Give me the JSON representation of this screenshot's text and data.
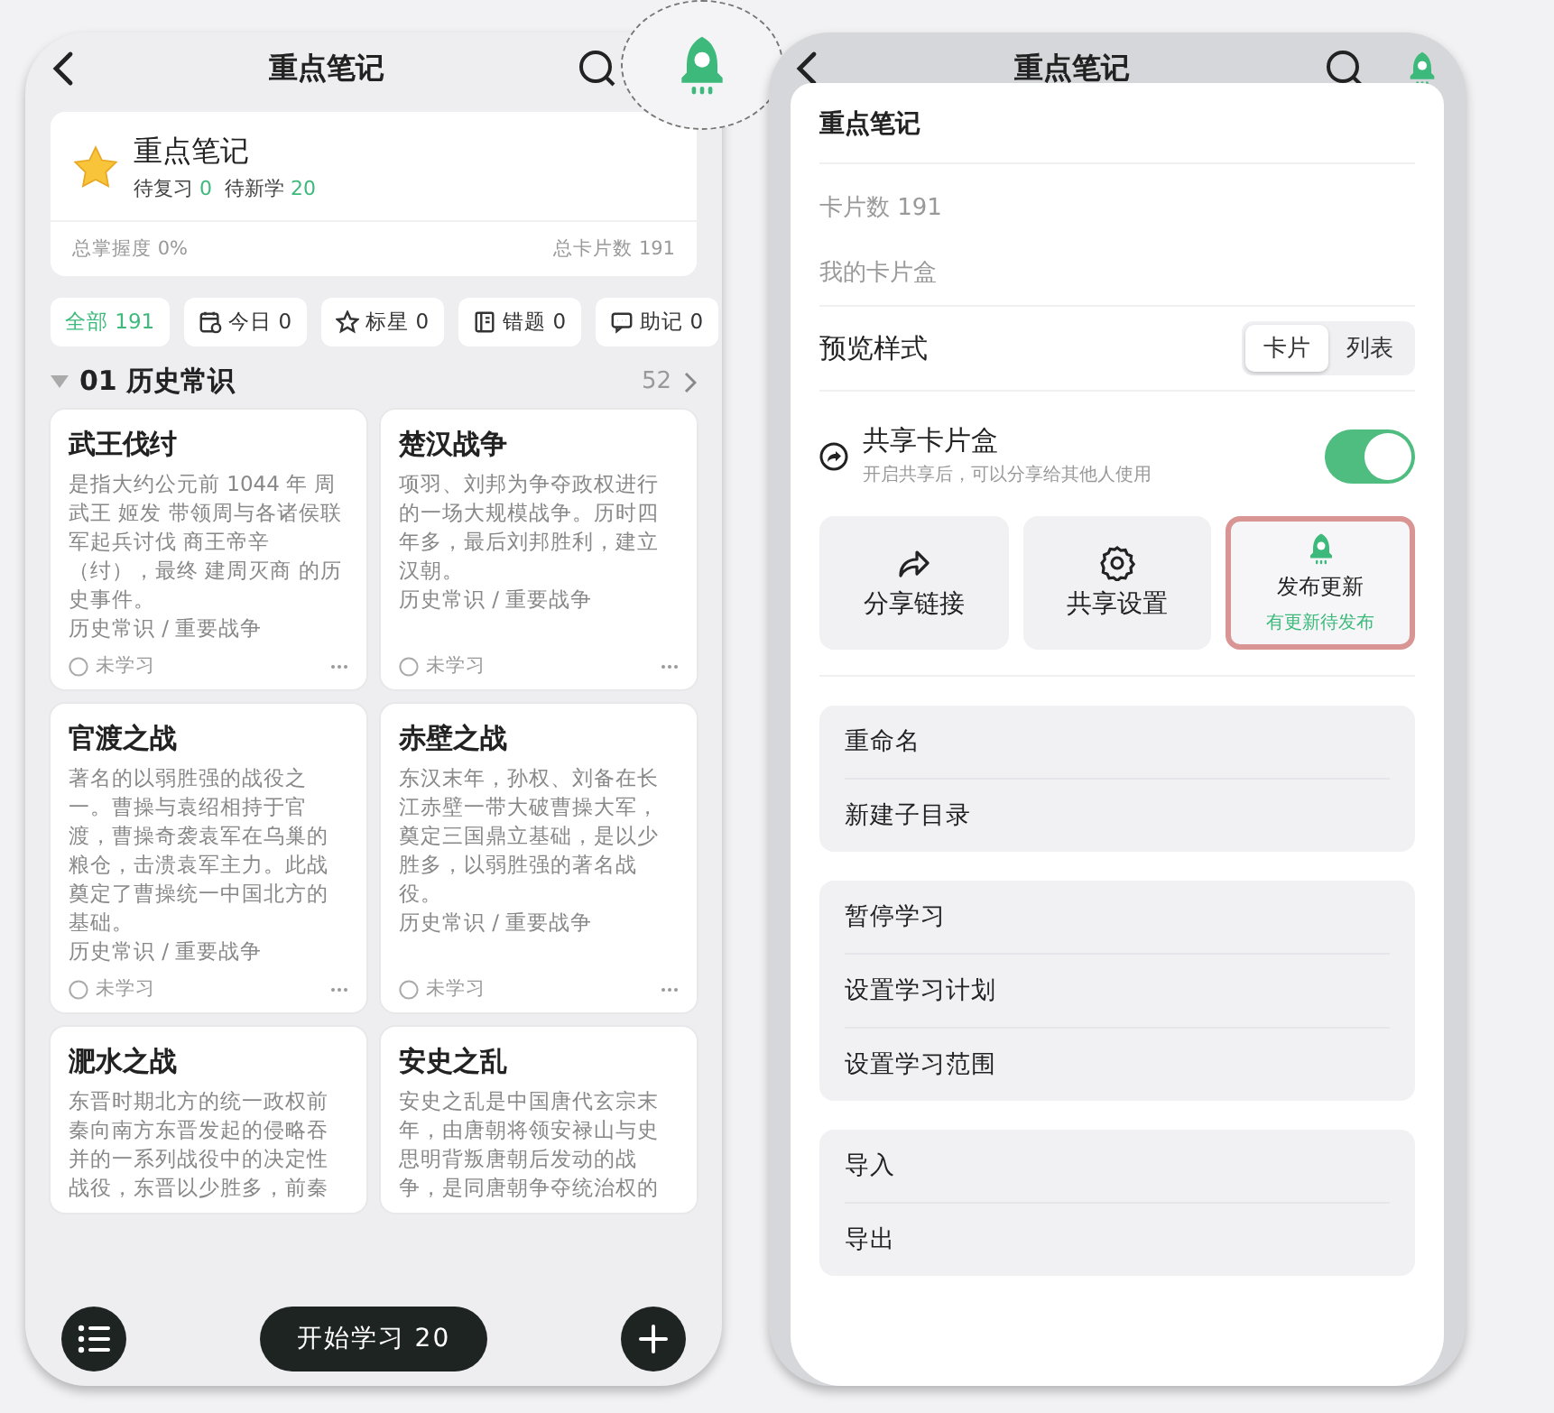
{
  "left": {
    "nav": {
      "title": "重点笔记",
      "rocket_highlighted": true
    },
    "deck": {
      "title": "重点笔记",
      "review_label": "待复习",
      "review_count": "0",
      "new_label": "待新学",
      "new_count": "20",
      "mastery": "总掌握度 0%",
      "total": "总卡片数 191"
    },
    "filters": [
      {
        "kind": "all",
        "label": "全部 191",
        "selected": true
      },
      {
        "kind": "today",
        "label": "今日 0",
        "selected": false
      },
      {
        "kind": "star",
        "label": "标星 0",
        "selected": false
      },
      {
        "kind": "wrong",
        "label": "错题 0",
        "selected": false
      },
      {
        "kind": "mnemonic",
        "label": "助记 0",
        "selected": false
      }
    ],
    "section": {
      "title": "01 历史常识",
      "count": "52",
      "expanded": true
    },
    "cards": [
      {
        "title": "武王伐纣",
        "description": "是指大约公元前 1044 年 周武王 姬发 带领周与各诸侯联军起兵讨伐 商王帝辛（纣），最终 建周灭商 的历史事件。",
        "category": "历史常识 / 重要战争",
        "status": "未学习"
      },
      {
        "title": "楚汉战争",
        "description": "项羽、刘邦为争夺政权进行的一场大规模战争。历时四年多，最后刘邦胜利，建立汉朝。",
        "category": "历史常识 / 重要战争",
        "status": "未学习"
      },
      {
        "title": "官渡之战",
        "description": "著名的以弱胜强的战役之一。曹操与袁绍相持于官渡，曹操奇袭袁军在乌巢的粮仓，击溃袁军主力。此战奠定了曹操统一中国北方的基础。",
        "category": "历史常识 / 重要战争",
        "status": "未学习"
      },
      {
        "title": "赤壁之战",
        "description": "东汉末年，孙权、刘备在长江赤壁一带大破曹操大军，奠定三国鼎立基础，是以少胜多，以弱胜强的著名战役。",
        "category": "历史常识 / 重要战争",
        "status": "未学习"
      },
      {
        "title": "淝水之战",
        "description": "东晋时期北方的统一政权前秦向南方东晋发起的侵略吞并的一系列战役中的决定性战役，东晋以少胜多，前秦"
      },
      {
        "title": "安史之乱",
        "description": "安史之乱是中国唐代玄宗末年，由唐朝将领安禄山与史思明背叛唐朝后发动的战争，是同唐朝争夺统治权的"
      }
    ],
    "start_button": "开始学习 20"
  },
  "right": {
    "nav": {
      "title": "重点笔记"
    },
    "sheet": {
      "title": "重点笔记",
      "card_count": "卡片数 191",
      "box_name": "我的卡片盒",
      "preview": {
        "label": "预览样式",
        "options": [
          {
            "label": "卡片",
            "selected": true
          },
          {
            "label": "列表",
            "selected": false
          }
        ]
      },
      "share": {
        "title": "共享卡片盒",
        "subtitle": "开启共享后，可以分享给其他人使用",
        "on": true
      },
      "tiles": [
        {
          "kind": "share",
          "label": "分享链接",
          "highlighted": false
        },
        {
          "kind": "settings",
          "label": "共享设置",
          "highlighted": false
        },
        {
          "kind": "publish",
          "label": "发布更新",
          "note": "有更新待发布",
          "highlighted": true
        }
      ],
      "groups": [
        [
          "重命名",
          "新建子目录"
        ],
        [
          "暂停学习",
          "设置学习计划",
          "设置学习范围"
        ],
        [
          "导入",
          "导出"
        ]
      ]
    }
  }
}
